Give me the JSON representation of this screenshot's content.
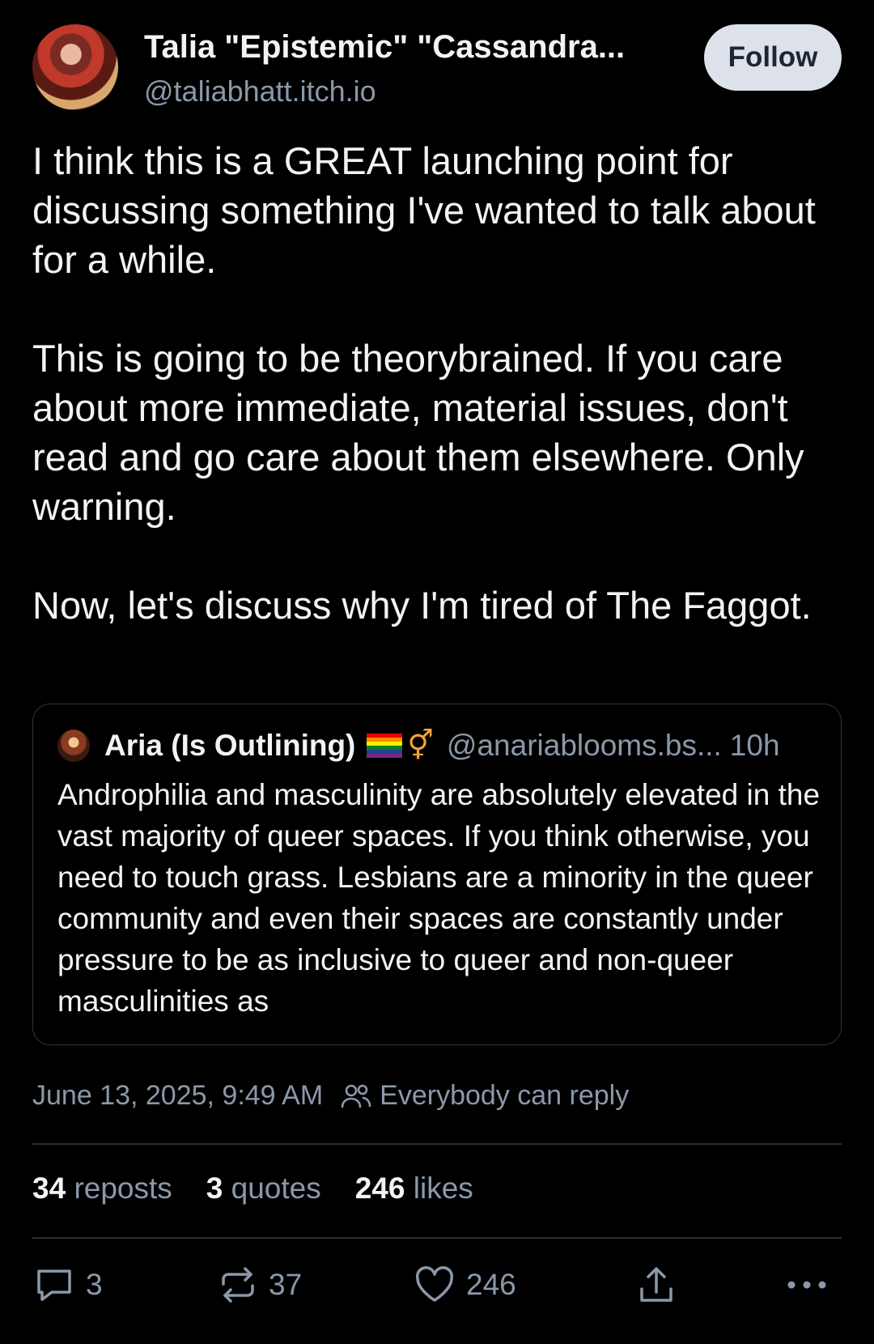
{
  "author": {
    "name": "Talia \"Epistemic\" \"Cassandra...",
    "handle": "@taliabhatt.itch.io",
    "follow_label": "Follow"
  },
  "post": {
    "paragraphs": [
      "I think this is a GREAT launching point for discussing something I've wanted to talk about for a while.",
      "This is going to be theorybrained. If you care about more immediate, material issues, don't read and go care about them elsewhere. Only warning.",
      "Now, let's discuss why I'm tired of The Faggot."
    ]
  },
  "quoted_post": {
    "name": "Aria (Is Outlining)",
    "handle": "@anariablooms.bs...",
    "time": "10h",
    "symbol": "⚥",
    "text": "Androphilia and masculinity are absolutely elevated in the vast majority of queer spaces. If you think otherwise, you need to touch grass. Lesbians are a minority in the queer community and even their spaces are constantly under pressure to be as inclusive to queer and non-queer masculinities as"
  },
  "meta": {
    "timestamp": "June 13, 2025, 9:49 AM",
    "reply_setting": "Everybody can reply"
  },
  "stats": {
    "reposts_count": "34",
    "reposts_label": "reposts",
    "quotes_count": "3",
    "quotes_label": "quotes",
    "likes_count": "246",
    "likes_label": "likes"
  },
  "actions": {
    "reply_count": "3",
    "repost_count": "37",
    "like_count": "246"
  },
  "colors": {
    "background": "#000000",
    "text": "#f1f3f5",
    "muted": "#8b98a9",
    "follow_bg": "#dde2ea",
    "border": "#2e3640"
  },
  "icons": [
    "people-icon",
    "reply-icon",
    "repost-icon",
    "like-icon",
    "share-icon",
    "more-icon"
  ]
}
